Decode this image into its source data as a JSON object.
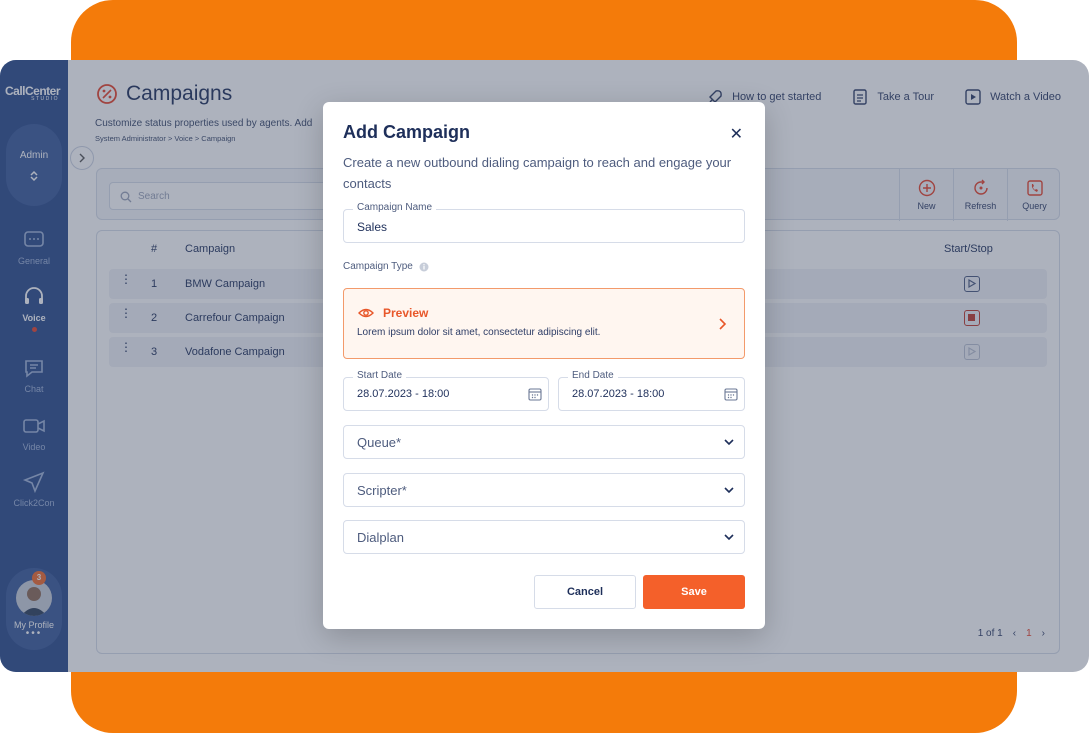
{
  "app": {
    "logo_main": "CallCenter",
    "logo_sub": "STUDIO"
  },
  "sidebar": {
    "role": "Admin",
    "items": [
      {
        "label": "General",
        "icon": "chat-bubble-dots-icon"
      },
      {
        "label": "Voice",
        "icon": "headset-icon",
        "active": true
      },
      {
        "label": "Chat",
        "icon": "chat-icon"
      },
      {
        "label": "Video",
        "icon": "video-camera-icon"
      },
      {
        "label": "Click2Con",
        "icon": "send-icon"
      }
    ],
    "profile": {
      "label": "My Profile",
      "badge": "3",
      "more": "•••"
    }
  },
  "header": {
    "title": "Campaigns",
    "subtitle": "Customize status properties used by agents. Add",
    "breadcrumb": "System Administrator > Voice > Campaign",
    "links": [
      "How to get started",
      "Take a Tour",
      "Watch a Video"
    ]
  },
  "toolbar": {
    "search_placeholder": "Search",
    "buttons": [
      "New",
      "Refresh",
      "Query"
    ]
  },
  "table": {
    "headers": {
      "num": "#",
      "campaign": "Campaign",
      "startstop": "Start/Stop"
    },
    "rows": [
      {
        "num": "1",
        "name": "BMW Campaign",
        "state": "play"
      },
      {
        "num": "2",
        "name": "Carrefour Campaign",
        "state": "stop"
      },
      {
        "num": "3",
        "name": "Vodafone Campaign",
        "state": "disabled"
      }
    ],
    "pager": {
      "info": "1 of 1",
      "current": "1"
    }
  },
  "modal": {
    "title": "Add Campaign",
    "close": "✕",
    "description": "Create a new outbound dialing campaign to reach and engage your contacts",
    "name_label": "Campaign Name",
    "name_value": "Sales",
    "type_label": "Campaign Type",
    "type_title": "Preview",
    "type_desc": "Lorem ipsum dolor sit amet, consectetur adipiscing elit.",
    "start_label": "Start Date",
    "start_value": "28.07.2023 - 18:00",
    "end_label": "End Date",
    "end_value": "28.07.2023 - 18:00",
    "queue": "Queue*",
    "scripter": "Scripter*",
    "dialplan": "Dialplan",
    "cancel": "Cancel",
    "save": "Save"
  },
  "colors": {
    "accent": "#F4602A",
    "sidebar": "#2A4A8B",
    "frame": "#F47B0A"
  }
}
